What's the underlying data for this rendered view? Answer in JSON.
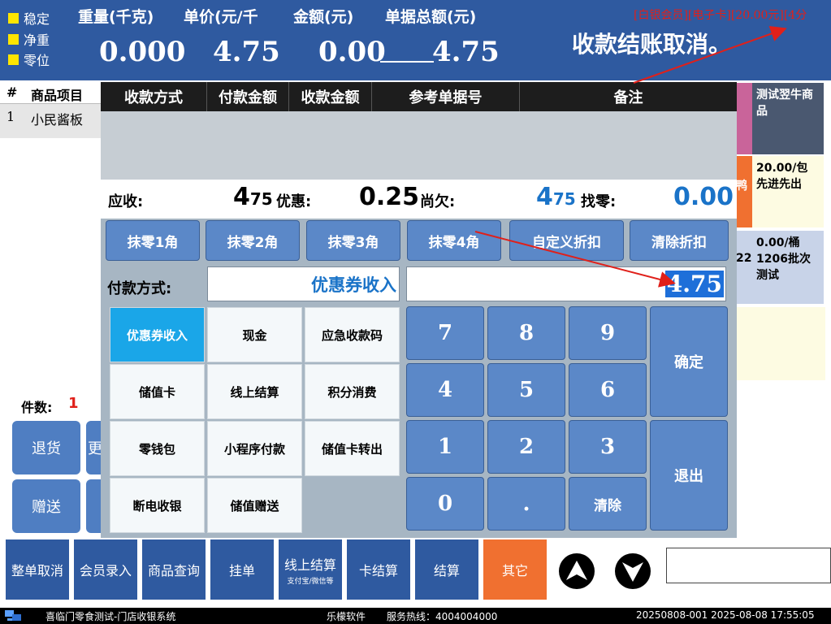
{
  "header": {
    "status": [
      "稳定",
      "净重",
      "零位"
    ],
    "weight_label": "重量(千克)",
    "price_label": "单价(元/千",
    "amount_label": "金额(元)",
    "total_label": "单据总额(元)",
    "weight_value": "0.000",
    "price_value": "4.75",
    "amount_value": "0.00",
    "total_value": "4.75",
    "member_info": "[白银会员][电子卡][20.00元][4分",
    "message": "收款结账取消。"
  },
  "table": {
    "col_index": "#",
    "col_item": "商品项目",
    "row1_index": "1",
    "row1_item": "小民酱板"
  },
  "tiles": {
    "tile1": "测试翌牛商品",
    "tile2_peek": "鸭",
    "tile2": "20.00/包 先进先出",
    "tile3_peek": "22",
    "tile3": "0.00/桶 1206批次测试"
  },
  "left_panel": {
    "count_label": "件数:",
    "count_value": "1",
    "return_btn": "退货",
    "gift_btn": "赠送",
    "peek_btn": "更"
  },
  "modal": {
    "columns": [
      "收款方式",
      "付款金额",
      "收款金额",
      "参考单据号",
      "备注"
    ],
    "receivable_label": "应收:",
    "receivable_main": "4",
    "receivable_small": "75",
    "discount_label": "优惠:",
    "discount_value": "0.25",
    "owed_label": "尚欠:",
    "owed_main": "4",
    "owed_small": "75",
    "change_label": "找零:",
    "change_value": "0.00",
    "discount_buttons": [
      "抹零1角",
      "抹零2角",
      "抹零3角",
      "抹零4角",
      "自定义折扣",
      "清除折扣"
    ],
    "pay_method_label": "付款方式:",
    "pay_method_value": "优惠券收入",
    "amount_value": "4.75",
    "pay_methods": [
      "优惠券收入",
      "现金",
      "应急收款码",
      "储值卡",
      "线上结算",
      "积分消费",
      "零钱包",
      "小程序付款",
      "储值卡转出",
      "断电收银",
      "储值赠送"
    ],
    "keys": [
      "7",
      "8",
      "9",
      "4",
      "5",
      "6",
      "1",
      "2",
      "3",
      "0",
      ".",
      "清除"
    ],
    "confirm": "确定",
    "exit": "退出"
  },
  "toolbar": {
    "cancel_order": "整单取消",
    "member_entry": "会员录入",
    "product_query": "商品查询",
    "hold_order": "挂单",
    "online_settle": "线上结算",
    "online_settle_sub": "支付宝/微信等",
    "card_settle": "卡结算",
    "settle": "结算",
    "other": "其它"
  },
  "statusbar": {
    "app_title": "喜临门零食测试-门店收银系统",
    "company": "乐檬软件",
    "hotline": "服务热线：4004004000",
    "datetime": "20250808-001 2025-08-08 17:55:05"
  },
  "colors": {
    "header_blue": "#2f5aa0",
    "button_blue": "#5b88c8",
    "accent_blue": "#1a73c8",
    "alert_red": "#e0201a",
    "orange": "#f07030"
  }
}
